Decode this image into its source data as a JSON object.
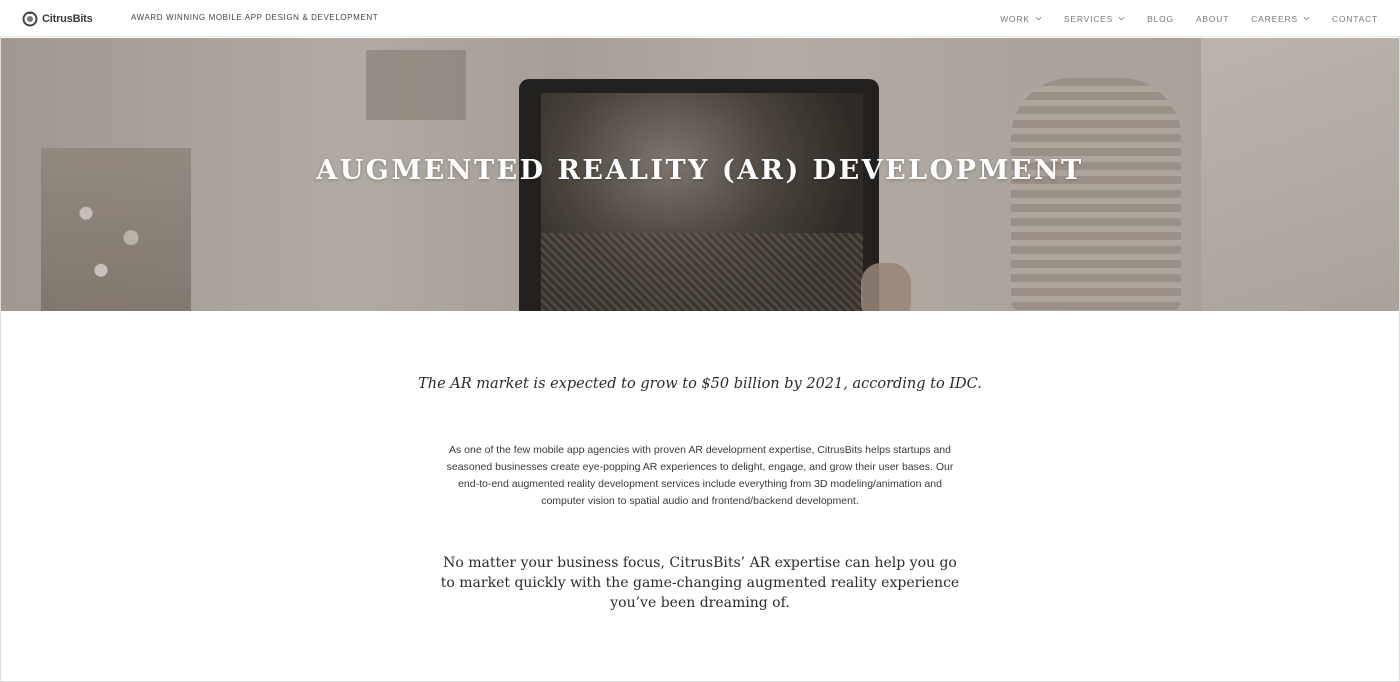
{
  "brand": {
    "name": "CitrusBits",
    "tagline": "AWARD WINNING MOBILE APP DESIGN & DEVELOPMENT",
    "logo_icon": "citrus-logo-icon"
  },
  "nav": {
    "items": [
      {
        "label": "WORK",
        "has_dropdown": true
      },
      {
        "label": "SERVICES",
        "has_dropdown": true
      },
      {
        "label": "BLOG",
        "has_dropdown": false
      },
      {
        "label": "ABOUT",
        "has_dropdown": false
      },
      {
        "label": "CAREERS",
        "has_dropdown": true
      },
      {
        "label": "CONTACT",
        "has_dropdown": false
      }
    ]
  },
  "hero": {
    "title": "AUGMENTED REALITY (AR) DEVELOPMENT"
  },
  "content": {
    "intro": "The AR market is expected to grow to $50 billion by 2021, according to IDC.",
    "paragraph": "As one of the few mobile app agencies with proven AR development expertise, CitrusBits helps startups and seasoned businesses create eye-popping AR experiences to delight, engage, and grow their user bases. Our end-to-end augmented reality development services include everything from 3D modeling/animation and computer vision to spatial audio and frontend/backend development.",
    "closing": "No matter your business focus, CitrusBits’ AR expertise can help you go to market quickly with the game-changing augmented reality experience you’ve been dreaming of."
  },
  "colors": {
    "nav_text": "#7a7a7a",
    "body_text": "#2b2b2b",
    "hero_title": "#ffffff"
  }
}
